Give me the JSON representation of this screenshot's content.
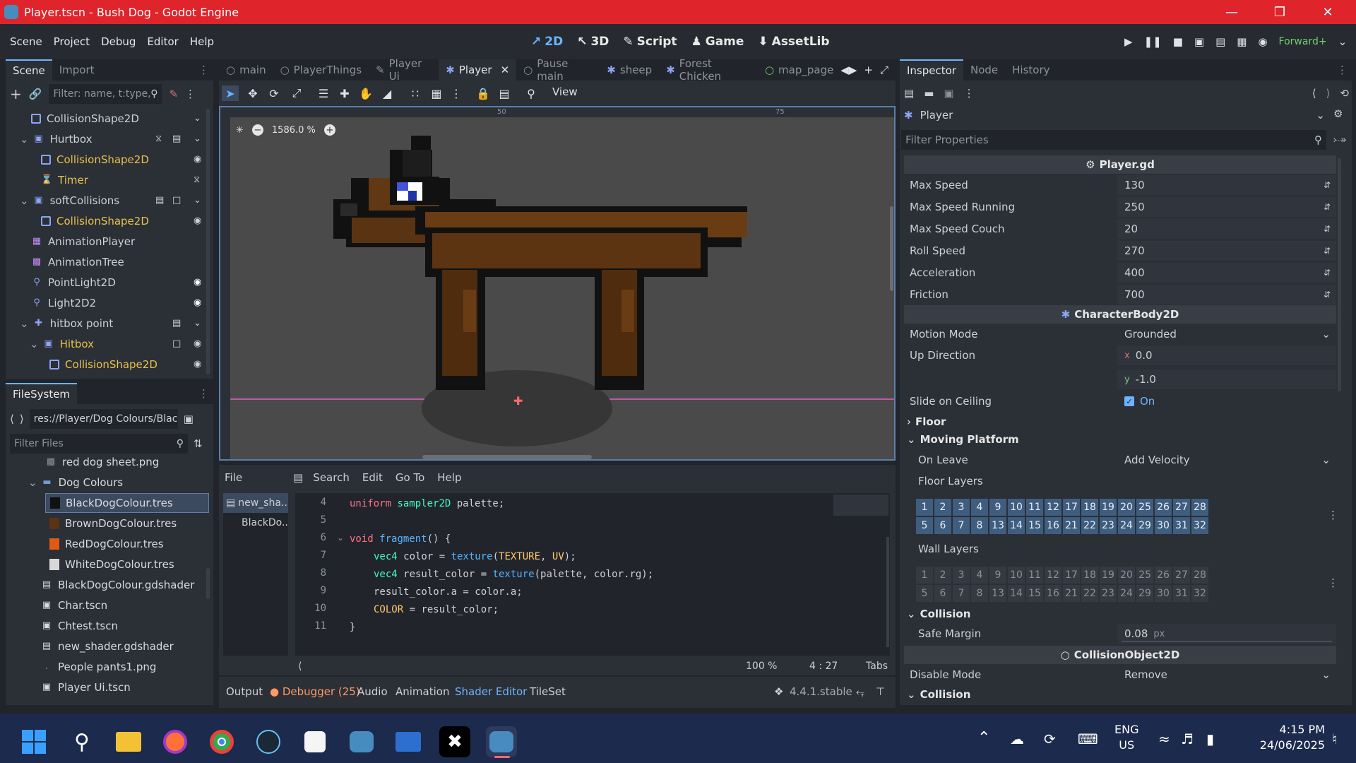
{
  "window": {
    "title": "Player.tscn - Bush Dog - Godot Engine"
  },
  "menu": [
    "Scene",
    "Project",
    "Debug",
    "Editor",
    "Help"
  ],
  "workspaces": [
    {
      "label": "2D",
      "icon": "2d-icon"
    },
    {
      "label": "3D",
      "icon": "3d-icon"
    },
    {
      "label": "Script",
      "icon": "script-icon"
    },
    {
      "label": "Game",
      "icon": "game-icon"
    },
    {
      "label": "AssetLib",
      "icon": "assetlib-icon"
    }
  ],
  "renderer": "Forward+",
  "scene_dock": {
    "tabs": [
      "Scene",
      "Import"
    ],
    "filter_placeholder": "Filter: name, t:type,",
    "nodes": [
      {
        "label": "CollisionShape2D",
        "icon": "collision-shape-icon",
        "yellow": false
      },
      {
        "label": "Hurtbox",
        "icon": "area2d-icon",
        "yellow": false
      },
      {
        "label": "CollisionShape2D",
        "icon": "collision-shape-icon",
        "yellow": true
      },
      {
        "label": "Timer",
        "icon": "timer-icon",
        "yellow": true
      },
      {
        "label": "softCollisions",
        "icon": "area2d-icon",
        "yellow": false
      },
      {
        "label": "CollisionShape2D",
        "icon": "collision-shape-icon",
        "yellow": true
      },
      {
        "label": "AnimationPlayer",
        "icon": "animation-player-icon",
        "yellow": false
      },
      {
        "label": "AnimationTree",
        "icon": "animation-tree-icon",
        "yellow": false
      },
      {
        "label": "PointLight2D",
        "icon": "light-icon",
        "yellow": false
      },
      {
        "label": "Light2D2",
        "icon": "light-icon",
        "yellow": false
      },
      {
        "label": "hitbox point",
        "icon": "marker-icon",
        "yellow": false
      },
      {
        "label": "Hitbox",
        "icon": "area2d-icon",
        "yellow": true
      },
      {
        "label": "CollisionShape2D",
        "icon": "collision-shape-icon",
        "yellow": true
      }
    ]
  },
  "filesystem": {
    "tab": "FileSystem",
    "path": "res://Player/Dog Colours/Blac",
    "filter_placeholder": "Filter Files",
    "items": [
      "red dog sheet.png",
      "Dog Colours",
      "BlackDogColour.tres",
      "BrownDogColour.tres",
      "RedDogColour.tres",
      "WhiteDogColour.tres",
      "BlackDogColour.gdshader",
      "Char.tscn",
      "Chtest.tscn",
      "new_shader.gdshader",
      "People pants1.png",
      "Player Ui.tscn"
    ]
  },
  "scene_tabs": [
    "main",
    "PlayerThings",
    "Player Ui",
    "Player",
    "Pause main",
    "sheep",
    "Forest Chicken",
    "map_page"
  ],
  "viewport": {
    "zoom": "1586.0 %",
    "view_label": "View",
    "ruler_50": "50",
    "ruler_75": "75"
  },
  "shader_editor": {
    "menu": [
      "File",
      "Search",
      "Edit",
      "Go To",
      "Help"
    ],
    "files": [
      "new_sha...",
      "BlackDo..."
    ],
    "zoom": "100 %",
    "cursor": "4 :  27",
    "indent": "Tabs",
    "lines": [
      {
        "n": "4",
        "code": "uniform sampler2D palette;"
      },
      {
        "n": "5",
        "code": ""
      },
      {
        "n": "6",
        "code": "void fragment() {"
      },
      {
        "n": "7",
        "code": "vec4 color = texture(TEXTURE, UV);"
      },
      {
        "n": "8",
        "code": "vec4 result_color = texture(palette, color.rg);"
      },
      {
        "n": "9",
        "code": "result_color.a = color.a;"
      },
      {
        "n": "10",
        "code": "COLOR = result_color;"
      },
      {
        "n": "11",
        "code": "}"
      }
    ]
  },
  "bottom_panel": {
    "tabs": [
      "Output",
      "Debugger (25)",
      "Audio",
      "Animation",
      "Shader Editor",
      "TileSet"
    ],
    "version": "4.4.1.stable"
  },
  "inspector": {
    "tabs": [
      "Inspector",
      "Node",
      "History"
    ],
    "object": "Player",
    "filter_placeholder": "Filter Properties",
    "script_section": "Player.gd",
    "script_props": [
      {
        "label": "Max Speed",
        "value": "130"
      },
      {
        "label": "Max Speed Running",
        "value": "250"
      },
      {
        "label": "Max Speed Couch",
        "value": "20"
      },
      {
        "label": "Roll Speed",
        "value": "270"
      },
      {
        "label": "Acceleration",
        "value": "400"
      },
      {
        "label": "Friction",
        "value": "700"
      }
    ],
    "body_section": "CharacterBody2D",
    "motion_mode": {
      "label": "Motion Mode",
      "value": "Grounded"
    },
    "up_direction": {
      "label": "Up Direction",
      "x": "0.0",
      "y": "-1.0"
    },
    "slide_on_ceiling": {
      "label": "Slide on Ceiling",
      "value": "On"
    },
    "floor_group": "Floor",
    "moving_platform_group": "Moving Platform",
    "on_leave": {
      "label": "On Leave",
      "value": "Add Velocity"
    },
    "floor_layers_label": "Floor Layers",
    "wall_layers_label": "Wall Layers",
    "layers_row1": [
      "1",
      "2",
      "3",
      "4",
      "9",
      "10",
      "11",
      "12",
      "17",
      "18",
      "19",
      "20",
      "25",
      "26",
      "27",
      "28"
    ],
    "layers_row2": [
      "5",
      "6",
      "7",
      "8",
      "13",
      "14",
      "15",
      "16",
      "21",
      "22",
      "23",
      "24",
      "29",
      "30",
      "31",
      "32"
    ],
    "collision_group": "Collision",
    "safe_margin": {
      "label": "Safe Margin",
      "value": "0.08",
      "unit": "px"
    },
    "collision_object_section": "CollisionObject2D",
    "disable_mode": {
      "label": "Disable Mode",
      "value": "Remove"
    },
    "collision_group2": "Collision"
  },
  "taskbar": {
    "lang1": "ENG",
    "lang2": "US",
    "time": "4:15 PM",
    "date": "24/06/2025"
  }
}
